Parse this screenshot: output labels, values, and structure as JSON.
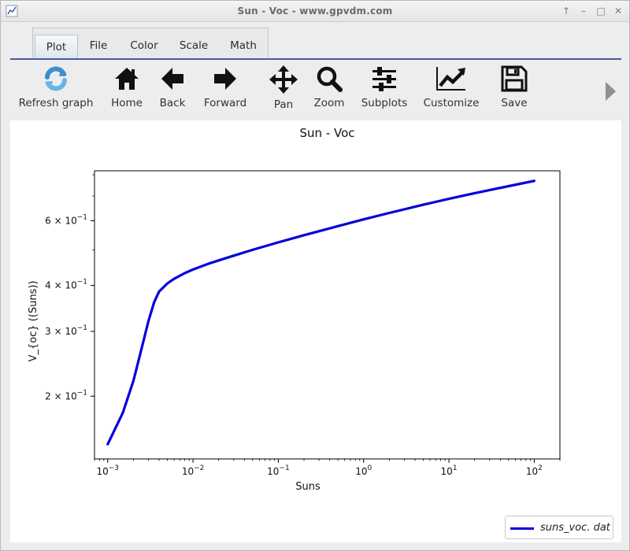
{
  "window": {
    "title": "Sun - Voc - www.gpvdm.com",
    "controls": [
      "↑",
      "–",
      "□",
      "✕"
    ]
  },
  "tabs": [
    {
      "label": "Plot",
      "active": true
    },
    {
      "label": "File",
      "active": false
    },
    {
      "label": "Color",
      "active": false
    },
    {
      "label": "Scale",
      "active": false
    },
    {
      "label": "Math",
      "active": false
    }
  ],
  "toolbar": {
    "refresh_label": "Refresh graph",
    "home_label": "Home",
    "back_label": "Back",
    "forward_label": "Forward",
    "pan_label": "Pan",
    "zoom_label": "Zoom",
    "subplots_label": "Subplots",
    "customize_label": "Customize",
    "save_label": "Save"
  },
  "colors": {
    "series": "#0000dd",
    "tab_underline": "#4a5a9a"
  },
  "chart_data": {
    "type": "line",
    "title": "Sun - Voc",
    "xlabel": "Suns",
    "ylabel": "V_{oc} ((Suns))",
    "xscale": "log",
    "yscale": "log",
    "xlim": [
      0.0007,
      200
    ],
    "ylim": [
      0.135,
      0.82
    ],
    "x_ticks": [
      {
        "value": 0.001,
        "base": "10",
        "exp": "−3"
      },
      {
        "value": 0.01,
        "base": "10",
        "exp": "−2"
      },
      {
        "value": 0.1,
        "base": "10",
        "exp": "−1"
      },
      {
        "value": 1,
        "base": "10",
        "exp": "0"
      },
      {
        "value": 10,
        "base": "10",
        "exp": "1"
      },
      {
        "value": 100,
        "base": "10",
        "exp": "2"
      }
    ],
    "y_ticks": [
      {
        "value": 0.2,
        "mant": "2 × 10",
        "exp": "−1"
      },
      {
        "value": 0.3,
        "mant": "3 × 10",
        "exp": "−1"
      },
      {
        "value": 0.4,
        "mant": "4 × 10",
        "exp": "−1"
      },
      {
        "value": 0.6,
        "mant": "6 × 10",
        "exp": "−1"
      }
    ],
    "grid": false,
    "legend_position": "bottom-right",
    "series": [
      {
        "name": "suns_voc. dat",
        "x": [
          0.001,
          0.0015,
          0.002,
          0.0025,
          0.003,
          0.0035,
          0.004,
          0.005,
          0.006,
          0.008,
          0.01,
          0.015,
          0.02,
          0.03,
          0.05,
          0.1,
          0.2,
          0.5,
          1,
          2,
          5,
          10,
          20,
          50,
          100
        ],
        "y": [
          0.148,
          0.18,
          0.22,
          0.27,
          0.32,
          0.36,
          0.385,
          0.405,
          0.417,
          0.432,
          0.442,
          0.458,
          0.468,
          0.482,
          0.5,
          0.524,
          0.548,
          0.58,
          0.605,
          0.63,
          0.663,
          0.688,
          0.713,
          0.745,
          0.77
        ]
      }
    ]
  }
}
